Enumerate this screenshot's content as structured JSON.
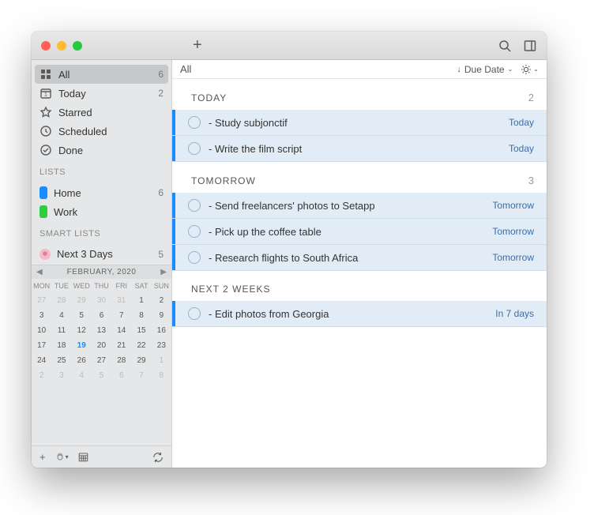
{
  "sidebar": {
    "smart": [
      {
        "icon": "grid",
        "label": "All",
        "count": "6",
        "selected": true
      },
      {
        "icon": "calendar-1",
        "label": "Today",
        "count": "2"
      },
      {
        "icon": "star",
        "label": "Starred",
        "count": ""
      },
      {
        "icon": "clock",
        "label": "Scheduled",
        "count": ""
      },
      {
        "icon": "check",
        "label": "Done",
        "count": ""
      }
    ],
    "lists_header": "LISTS",
    "lists": [
      {
        "color": "blue",
        "label": "Home",
        "count": "6"
      },
      {
        "color": "green",
        "label": "Work",
        "count": ""
      }
    ],
    "smartlists_header": "SMART LISTS",
    "smartlists": [
      {
        "icon": "flower",
        "label": "Next 3 Days",
        "count": "5"
      }
    ]
  },
  "calendar": {
    "title": "FEBRUARY, 2020",
    "dow": [
      "MON",
      "TUE",
      "WED",
      "THU",
      "FRI",
      "SAT",
      "SUN"
    ],
    "days": [
      {
        "n": "27",
        "o": true
      },
      {
        "n": "28",
        "o": true
      },
      {
        "n": "29",
        "o": true
      },
      {
        "n": "30",
        "o": true
      },
      {
        "n": "31",
        "o": true
      },
      {
        "n": "1"
      },
      {
        "n": "2"
      },
      {
        "n": "3"
      },
      {
        "n": "4"
      },
      {
        "n": "5"
      },
      {
        "n": "6"
      },
      {
        "n": "7"
      },
      {
        "n": "8"
      },
      {
        "n": "9"
      },
      {
        "n": "10"
      },
      {
        "n": "11"
      },
      {
        "n": "12"
      },
      {
        "n": "13"
      },
      {
        "n": "14"
      },
      {
        "n": "15"
      },
      {
        "n": "16"
      },
      {
        "n": "17"
      },
      {
        "n": "18"
      },
      {
        "n": "19",
        "t": true
      },
      {
        "n": "20"
      },
      {
        "n": "21"
      },
      {
        "n": "22"
      },
      {
        "n": "23"
      },
      {
        "n": "24"
      },
      {
        "n": "25"
      },
      {
        "n": "26"
      },
      {
        "n": "27"
      },
      {
        "n": "28"
      },
      {
        "n": "29"
      },
      {
        "n": "1",
        "o": true
      },
      {
        "n": "2",
        "o": true
      },
      {
        "n": "3",
        "o": true
      },
      {
        "n": "4",
        "o": true
      },
      {
        "n": "5",
        "o": true
      },
      {
        "n": "6",
        "o": true
      },
      {
        "n": "7",
        "o": true
      },
      {
        "n": "8",
        "o": true
      }
    ]
  },
  "main": {
    "title": "All",
    "sort_label": "Due Date",
    "sections": [
      {
        "header": "TODAY",
        "count": "2",
        "tasks": [
          {
            "title": "- Study subjonctif",
            "due": "Today"
          },
          {
            "title": "- Write the film script",
            "due": "Today"
          }
        ]
      },
      {
        "header": "TOMORROW",
        "count": "3",
        "tasks": [
          {
            "title": "- Send freelancers' photos to Setapp",
            "due": "Tomorrow"
          },
          {
            "title": "- Pick up the coffee table",
            "due": "Tomorrow"
          },
          {
            "title": "- Research flights to South Africa",
            "due": "Tomorrow"
          }
        ]
      },
      {
        "header": "NEXT 2 WEEKS",
        "count": "",
        "tasks": [
          {
            "title": "- Edit photos from Georgia",
            "due": "In 7 days"
          }
        ]
      }
    ]
  }
}
